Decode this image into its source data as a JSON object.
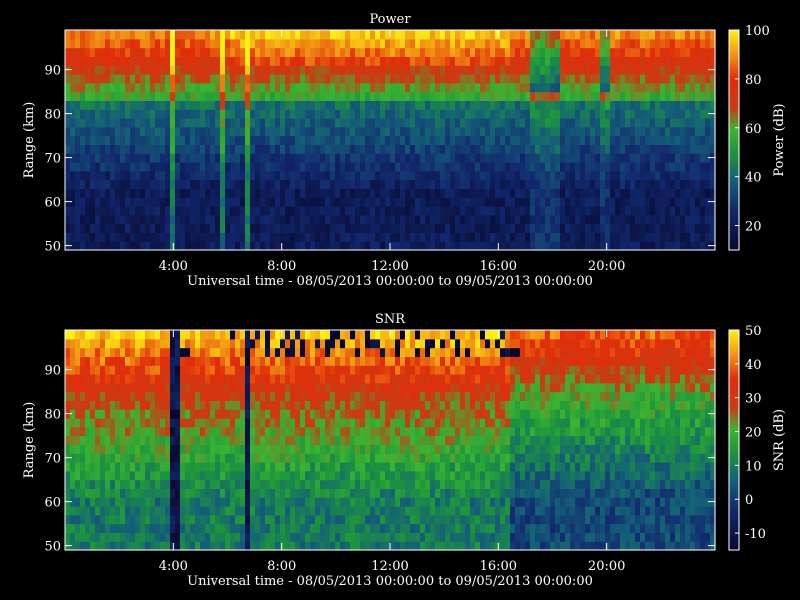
{
  "chart_data": [
    {
      "type": "heatmap",
      "title": "Power",
      "xlabel": "Universal time - 08/05/2013 00:00:00 to 09/05/2013 00:00:00",
      "ylabel": "Range (km)",
      "xlim": [
        0,
        24
      ],
      "ylim": [
        49,
        99
      ],
      "xticks": [
        {
          "value": 4,
          "label": "4:00"
        },
        {
          "value": 8,
          "label": "8:00"
        },
        {
          "value": 12,
          "label": "12:00"
        },
        {
          "value": 16,
          "label": "16:00"
        },
        {
          "value": 20,
          "label": "20:00"
        }
      ],
      "yticks": [
        {
          "value": 50,
          "label": "50"
        },
        {
          "value": 60,
          "label": "60"
        },
        {
          "value": 70,
          "label": "70"
        },
        {
          "value": 80,
          "label": "80"
        },
        {
          "value": 90,
          "label": "90"
        }
      ],
      "colorbar": {
        "label": "Power (dB)",
        "range": [
          10,
          100
        ],
        "ticks": [
          {
            "value": 20,
            "label": "20"
          },
          {
            "value": 40,
            "label": "40"
          },
          {
            "value": 60,
            "label": "60"
          },
          {
            "value": 80,
            "label": "80"
          },
          {
            "value": 100,
            "label": "100"
          }
        ]
      }
    },
    {
      "type": "heatmap",
      "title": "SNR",
      "xlabel": "Universal time - 08/05/2013 00:00:00 to 09/05/2013 00:00:00",
      "ylabel": "Range (km)",
      "xlim": [
        0,
        24
      ],
      "ylim": [
        49,
        99
      ],
      "xticks": [
        {
          "value": 4,
          "label": "4:00"
        },
        {
          "value": 8,
          "label": "8:00"
        },
        {
          "value": 12,
          "label": "12:00"
        },
        {
          "value": 16,
          "label": "16:00"
        },
        {
          "value": 20,
          "label": "20:00"
        }
      ],
      "yticks": [
        {
          "value": 50,
          "label": "50"
        },
        {
          "value": 60,
          "label": "60"
        },
        {
          "value": 70,
          "label": "70"
        },
        {
          "value": 80,
          "label": "80"
        },
        {
          "value": 90,
          "label": "90"
        }
      ],
      "colorbar": {
        "label": "SNR (dB)",
        "range": [
          -15,
          50
        ],
        "ticks": [
          {
            "value": -10,
            "label": "-10"
          },
          {
            "value": 0,
            "label": "0"
          },
          {
            "value": 10,
            "label": "10"
          },
          {
            "value": 20,
            "label": "20"
          },
          {
            "value": 30,
            "label": "30"
          },
          {
            "value": 40,
            "label": "40"
          },
          {
            "value": 50,
            "label": "50"
          }
        ]
      }
    }
  ]
}
